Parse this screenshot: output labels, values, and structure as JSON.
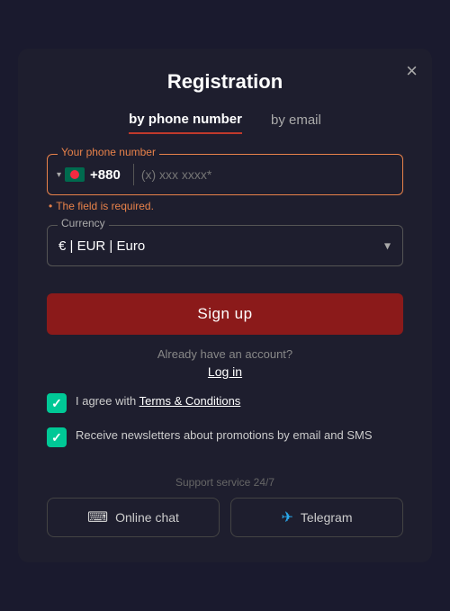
{
  "modal": {
    "title": "Registration",
    "close_label": "×"
  },
  "tabs": [
    {
      "id": "phone",
      "label": "by phone number",
      "active": true
    },
    {
      "id": "email",
      "label": "by email",
      "active": false
    }
  ],
  "phone_field": {
    "label": "Your phone number",
    "country_code": "+880",
    "placeholder": "(x) xxx xxxx*",
    "error": "The field is required."
  },
  "currency_field": {
    "label": "Currency",
    "selected": "€ | EUR | Euro"
  },
  "buttons": {
    "signup": "Sign up",
    "login": "Log in"
  },
  "already_text": "Already have an account?",
  "checkboxes": [
    {
      "id": "terms",
      "label_prefix": "I agree with ",
      "link_text": "Terms & Conditions",
      "label_suffix": "",
      "checked": true
    },
    {
      "id": "newsletters",
      "label": "Receive newsletters about promotions by email and SMS",
      "checked": true
    }
  ],
  "support": {
    "label": "Support service 24/7",
    "buttons": [
      {
        "id": "chat",
        "label": "Online chat",
        "icon": "chat"
      },
      {
        "id": "telegram",
        "label": "Telegram",
        "icon": "telegram"
      }
    ]
  }
}
